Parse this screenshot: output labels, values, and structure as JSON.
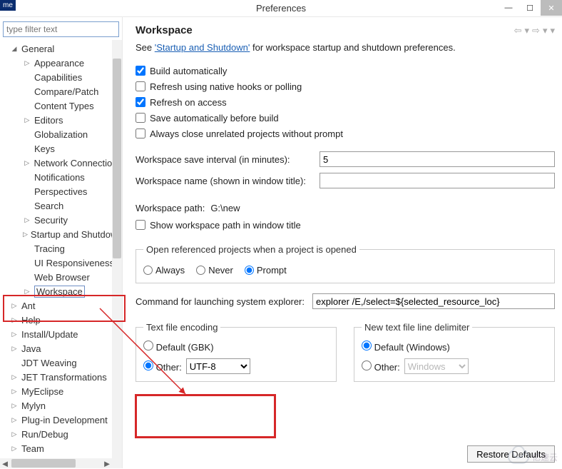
{
  "titlebar": {
    "title": "Preferences",
    "badge": "me"
  },
  "sidebar": {
    "filter_placeholder": "type filter text",
    "nodes": [
      {
        "label": "General",
        "level": 0,
        "exp": true
      },
      {
        "label": "Appearance",
        "level": 1,
        "exp": false,
        "arrow": true
      },
      {
        "label": "Capabilities",
        "level": 1
      },
      {
        "label": "Compare/Patch",
        "level": 1
      },
      {
        "label": "Content Types",
        "level": 1
      },
      {
        "label": "Editors",
        "level": 1,
        "arrow": true
      },
      {
        "label": "Globalization",
        "level": 1
      },
      {
        "label": "Keys",
        "level": 1
      },
      {
        "label": "Network Connections",
        "level": 1,
        "arrow": true
      },
      {
        "label": "Notifications",
        "level": 1
      },
      {
        "label": "Perspectives",
        "level": 1
      },
      {
        "label": "Search",
        "level": 1
      },
      {
        "label": "Security",
        "level": 1,
        "arrow": true
      },
      {
        "label": "Startup and Shutdown",
        "level": 1,
        "arrow": true
      },
      {
        "label": "Tracing",
        "level": 1
      },
      {
        "label": "UI Responsiveness",
        "level": 1
      },
      {
        "label": "Web Browser",
        "level": 1
      },
      {
        "label": "Workspace",
        "level": 1,
        "arrow": true,
        "selected": true
      },
      {
        "label": "Ant",
        "level": 0,
        "arrow": true
      },
      {
        "label": "Help",
        "level": 0,
        "arrow": true
      },
      {
        "label": "Install/Update",
        "level": 0,
        "arrow": true
      },
      {
        "label": "Java",
        "level": 0,
        "arrow": true
      },
      {
        "label": "JDT Weaving",
        "level": 0
      },
      {
        "label": "JET Transformations",
        "level": 0,
        "arrow": true
      },
      {
        "label": "MyEclipse",
        "level": 0,
        "arrow": true
      },
      {
        "label": "Mylyn",
        "level": 0,
        "arrow": true
      },
      {
        "label": "Plug-in Development",
        "level": 0,
        "arrow": true
      },
      {
        "label": "Run/Debug",
        "level": 0,
        "arrow": true
      },
      {
        "label": "Team",
        "level": 0,
        "arrow": true
      }
    ]
  },
  "main": {
    "heading": "Workspace",
    "intro_prefix": "See ",
    "intro_link": "'Startup and Shutdown'",
    "intro_suffix": " for workspace startup and shutdown preferences.",
    "checks": {
      "build_auto": "Build automatically",
      "refresh_native": "Refresh using native hooks or polling",
      "refresh_access": "Refresh on access",
      "save_before": "Save automatically before build",
      "close_unrelated": "Always close unrelated projects without prompt"
    },
    "save_interval_label": "Workspace save interval (in minutes):",
    "save_interval_value": "5",
    "ws_name_label": "Workspace name (shown in window title):",
    "ws_name_value": "",
    "ws_path_label": "Workspace path:",
    "ws_path_value": "G:\\new",
    "show_path": "Show workspace path in window title",
    "open_ref_legend": "Open referenced projects when a project is opened",
    "radio_always": "Always",
    "radio_never": "Never",
    "radio_prompt": "Prompt",
    "cmd_label": "Command for launching system explorer:",
    "cmd_value": "explorer /E,/select=${selected_resource_loc}",
    "enc_legend": "Text file encoding",
    "enc_default": "Default (GBK)",
    "enc_other": "Other:",
    "enc_value": "UTF-8",
    "delim_legend": "New text file line delimiter",
    "delim_default": "Default (Windows)",
    "delim_other": "Other:",
    "delim_value": "Windows",
    "restore": "Restore Defaults"
  },
  "watermark": "亿速云"
}
